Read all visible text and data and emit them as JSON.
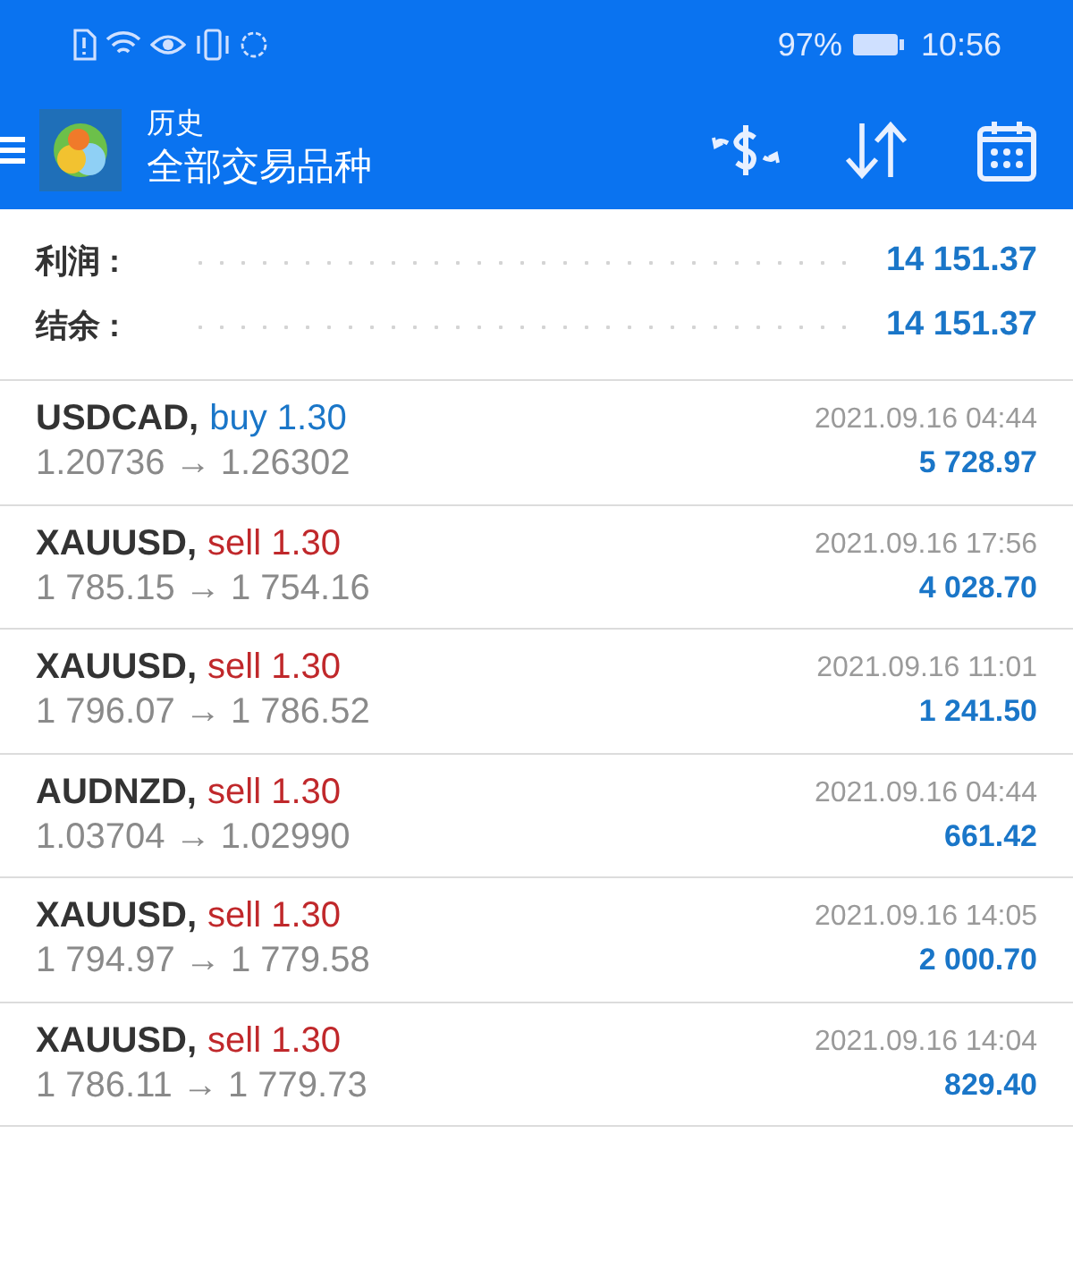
{
  "status_bar": {
    "battery": "97%",
    "time": "10:56"
  },
  "header": {
    "title": "历史",
    "subtitle": "全部交易品种"
  },
  "summary": [
    {
      "label": "利润 :",
      "value": "14 151.37"
    },
    {
      "label": "结余 :",
      "value": "14 151.37"
    }
  ],
  "trades": [
    {
      "symbol": "USDCAD,",
      "kind": "buy",
      "order": "buy 1.30",
      "prices": "1.20736 → 1.26302",
      "time": "2021.09.16 04:44",
      "profit": "5 728.97"
    },
    {
      "symbol": "XAUUSD,",
      "kind": "sell",
      "order": "sell 1.30",
      "prices": "1 785.15 → 1 754.16",
      "time": "2021.09.16 17:56",
      "profit": "4 028.70"
    },
    {
      "symbol": "XAUUSD,",
      "kind": "sell",
      "order": "sell 1.30",
      "prices": "1 796.07 → 1 786.52",
      "time": "2021.09.16 11:01",
      "profit": "1 241.50"
    },
    {
      "symbol": "AUDNZD,",
      "kind": "sell",
      "order": "sell 1.30",
      "prices": "1.03704 → 1.02990",
      "time": "2021.09.16 04:44",
      "profit": "661.42"
    },
    {
      "symbol": "XAUUSD,",
      "kind": "sell",
      "order": "sell 1.30",
      "prices": "1 794.97 → 1 779.58",
      "time": "2021.09.16 14:05",
      "profit": "2 000.70"
    },
    {
      "symbol": "XAUUSD,",
      "kind": "sell",
      "order": "sell 1.30",
      "prices": "1 786.11 → 1 779.73",
      "time": "2021.09.16 14:04",
      "profit": "829.40"
    }
  ]
}
